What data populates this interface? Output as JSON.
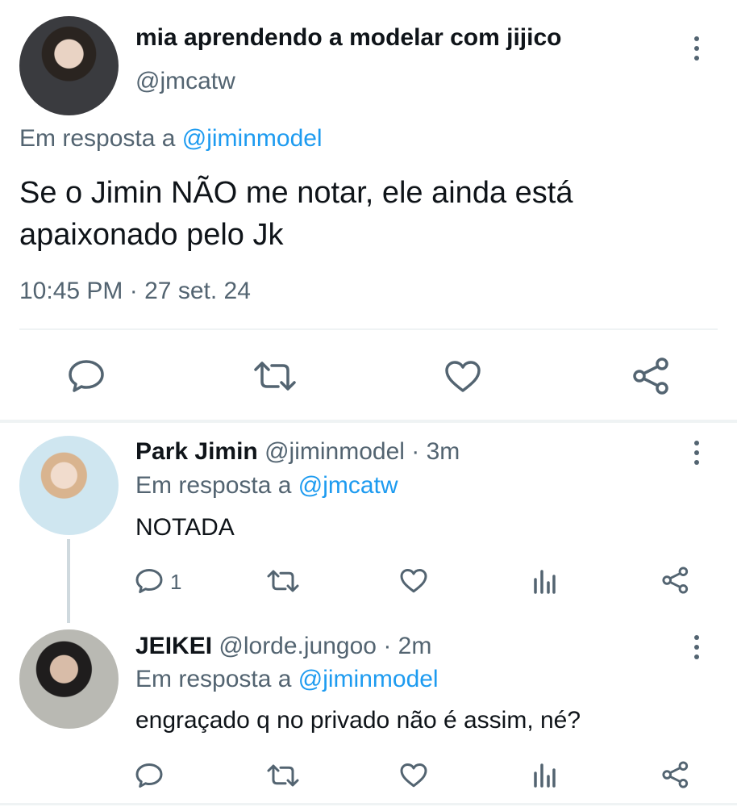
{
  "main_tweet": {
    "display_name": "mia aprendendo a modelar com jijico",
    "handle": "@jmcatw",
    "reply_prefix": "Em resposta a",
    "reply_to": "@jiminmodel",
    "text": "Se o Jimin NÃO me notar, ele ainda está apaixonado pelo Jk",
    "time": "10:45 PM",
    "separator": "·",
    "date": "27 set. 24",
    "actions": [
      "reply-icon",
      "retweet-icon",
      "like-icon",
      "share-icon"
    ]
  },
  "replies": [
    {
      "display_name": "Park Jimin",
      "handle": "@jiminmodel",
      "separator": "·",
      "time_ago": "3m",
      "reply_prefix": "Em resposta a",
      "reply_to": "@jmcatw",
      "text": "NOTADA",
      "reply_count": "1"
    },
    {
      "display_name": "JEIKEI",
      "handle": "@lorde.jungoo",
      "separator": "·",
      "time_ago": "2m",
      "reply_prefix": "Em resposta a",
      "reply_to": "@jiminmodel",
      "text": "engraçado q no privado não é assim, né?",
      "reply_count": ""
    }
  ],
  "colors": {
    "text": "#0f1419",
    "muted": "#536471",
    "link": "#1d9bf0",
    "divider": "#eff3f4"
  }
}
